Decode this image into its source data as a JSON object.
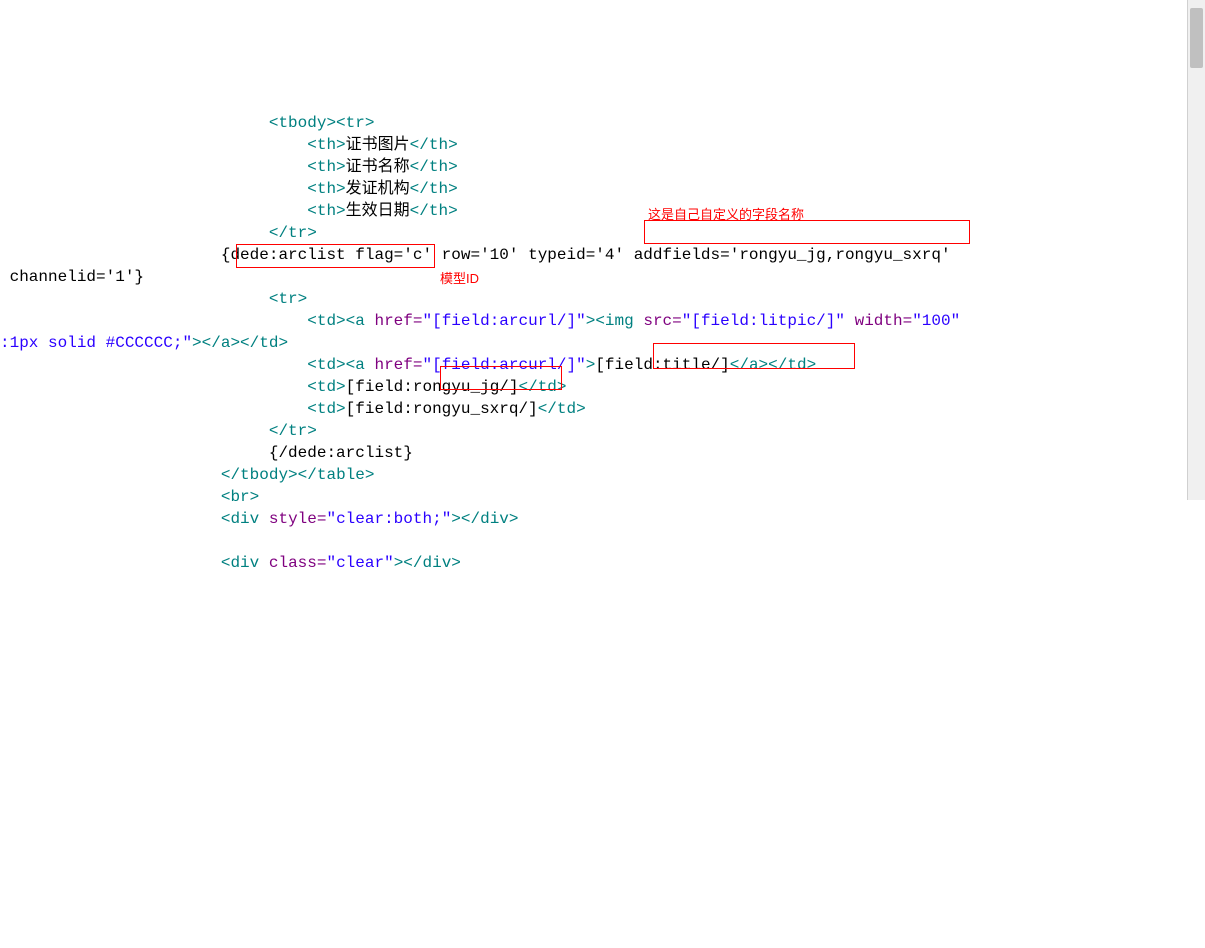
{
  "annotations": {
    "label_addfields": "这是自己自定义的字段名称",
    "label_modelid": "模型ID"
  },
  "code": {
    "indent_root": "                       ",
    "indent1": "                            ",
    "indent2": "                                ",
    "tbody_open": "<tbody><tr>",
    "th1_open": "<th>",
    "th1_text": "证书图片",
    "th1_close": "</th>",
    "th2_open": "<th>",
    "th2_text": "证书名称",
    "th2_close": "</th>",
    "th3_open": "<th>",
    "th3_text": "发证机构",
    "th3_close": "</th>",
    "th4_open": "<th>",
    "th4_text": "生效日期",
    "th4_close": "</th>",
    "tr_close": "</tr>",
    "arclist_open": "{dede:arclist flag='c' row='10' typeid='4' addfields='rongyu_jg,rongyu_sxrq' channelid='1'}",
    "arclist_line1_a": "                       {dede:arclist flag='c' row='10' typeid='4' ",
    "arclist_line1_b": "addfields='rongyu_jg,rongyu_sxrq'",
    "arclist_line2_a": " channelid='1'",
    "arclist_line2_b": "}",
    "tr_open": "<tr>",
    "td1_part1": "<td><a href=\"[field:arcurl/]\"><img src=\"[field:litpic/]\" width=\"100\"",
    "td1_part2_left": ":1px solid #CCCCCC;",
    "td1_part2_mid": "\">",
    "td1_part2_close": "</a></td>",
    "td2_a": "<td><a href=\"[field:arcurl/]\">",
    "td2_b": "[field:title/]",
    "td2_c": "</a></td>",
    "td3_a": "<td>",
    "td3_b": "[field:",
    "td3_c": "rongyu_jg/]",
    "td3_d": "</td>",
    "td4_a": "<td>",
    "td4_b": "[field:rongyu_sxrq/]",
    "td4_c": "</td>",
    "arclist_close": "{/dede:arclist}",
    "tbody_close": "</tbody></table>",
    "br": "<br>",
    "div1_a": "<div style=\"clear:both;\">",
    "div1_b": "</div>",
    "div2_a": "<div class=\"clear\">",
    "div2_b": "</div>"
  }
}
